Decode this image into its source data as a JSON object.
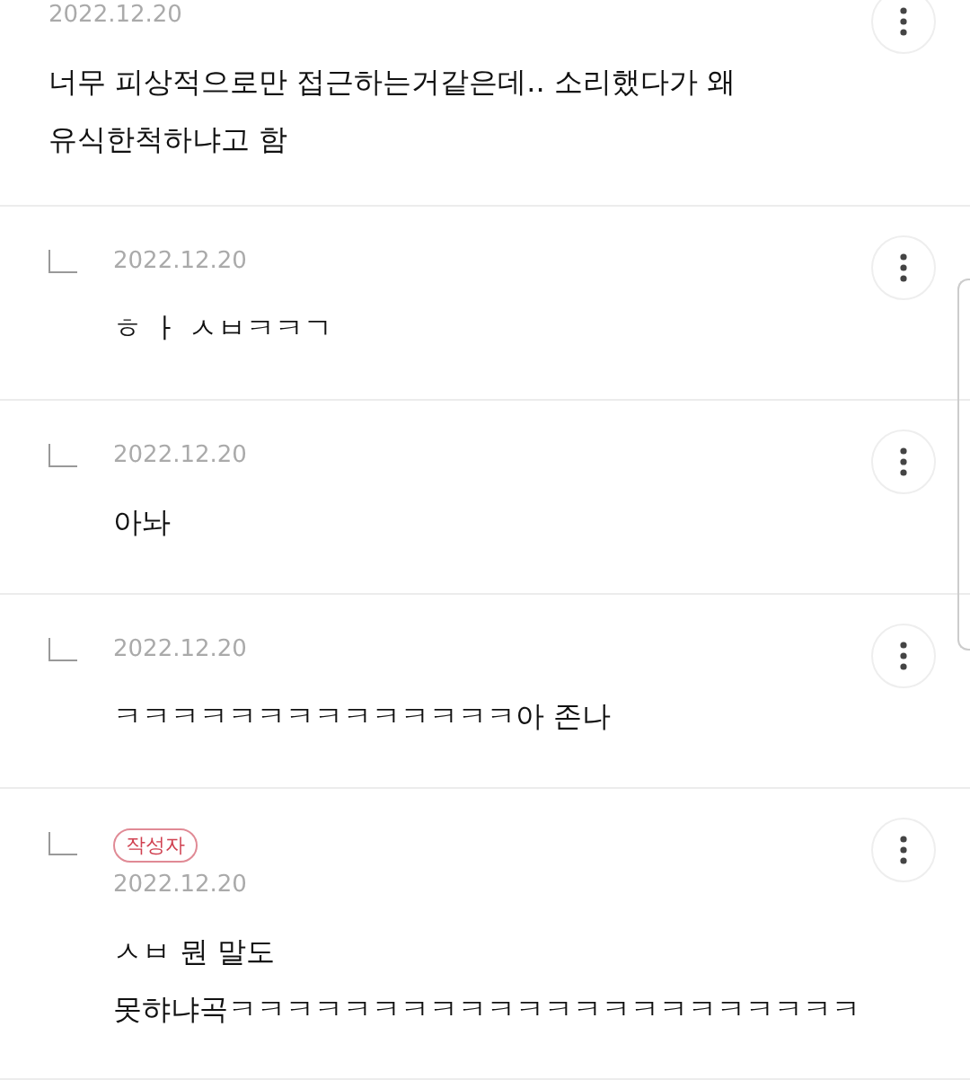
{
  "comments": [
    {
      "kind": "comment",
      "date": "2022.12.20",
      "text_lines": [
        "너무 피상적으로만 접근하는거같은데.. 소리했다가 왜",
        "유식한척하냐고 함"
      ]
    },
    {
      "kind": "reply",
      "date": "2022.12.20",
      "text_lines": [
        "ㅎ ㅏ ㅅㅂㅋㅋㄱ"
      ]
    },
    {
      "kind": "reply",
      "date": "2022.12.20",
      "text_lines": [
        "아놔"
      ]
    },
    {
      "kind": "reply",
      "date": "2022.12.20",
      "text_lines": [
        "ㅋㅋㅋㅋㅋㅋㅋㅋㅋㅋㅋㅋㅋㅋ아 존나"
      ]
    },
    {
      "kind": "reply",
      "badge": "작성자",
      "date": "2022.12.20",
      "text_lines": [
        "ㅅㅂ 뭔 말도",
        "못햐냐곡ㅋㅋㅋㅋㅋㅋㅋㅋㅋㅋㅋㅋㅋㅋㅋㅋㅋㅋㅋㅋㅋㅋ"
      ]
    }
  ]
}
